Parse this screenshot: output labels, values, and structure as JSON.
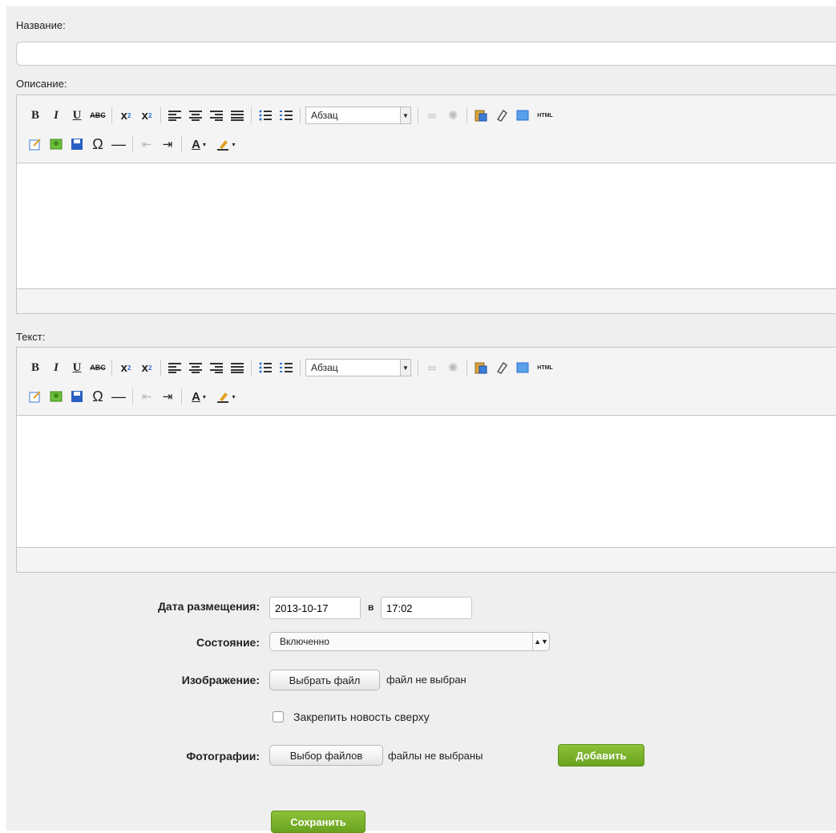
{
  "title_field": {
    "label": "Название:",
    "value": ""
  },
  "description_editor": {
    "label": "Описание:",
    "format_value": "Абзац",
    "html_label": "HTML"
  },
  "text_editor": {
    "label": "Текст:",
    "format_value": "Абзац",
    "html_label": "HTML"
  },
  "publish_date": {
    "label": "Дата размещения:",
    "date": "2013-10-17",
    "at": "в",
    "time": "17:02"
  },
  "state": {
    "label": "Состояние:",
    "value": "Включенно"
  },
  "image": {
    "label": "Изображение:",
    "button": "Выбрать файл",
    "status": "файл не выбран"
  },
  "pin": {
    "label": "Закрепить новость сверху"
  },
  "photos": {
    "label": "Фотографии:",
    "button": "Выбор файлов",
    "status": "файлы не выбраны",
    "add_button": "Добавить"
  },
  "save_button": "Сохранить",
  "colors": {
    "accent_green": "#78b12a",
    "panel": "#efefef"
  },
  "toolbar_icons": [
    "bold-icon",
    "italic-icon",
    "underline-icon",
    "strikethrough-icon",
    "subscript-icon",
    "superscript-icon",
    "align-left-icon",
    "align-center-icon",
    "align-right-icon",
    "align-justify-icon",
    "bullet-list-icon",
    "numbered-list-icon",
    "link-icon",
    "unlink-icon",
    "paste-word-icon",
    "cleanup-icon",
    "image-icon",
    "html-icon",
    "edit-icon",
    "insert-image-icon",
    "save-icon",
    "omega-icon",
    "horizontal-rule-icon",
    "outdent-icon",
    "indent-icon",
    "text-color-icon",
    "highlight-icon"
  ]
}
